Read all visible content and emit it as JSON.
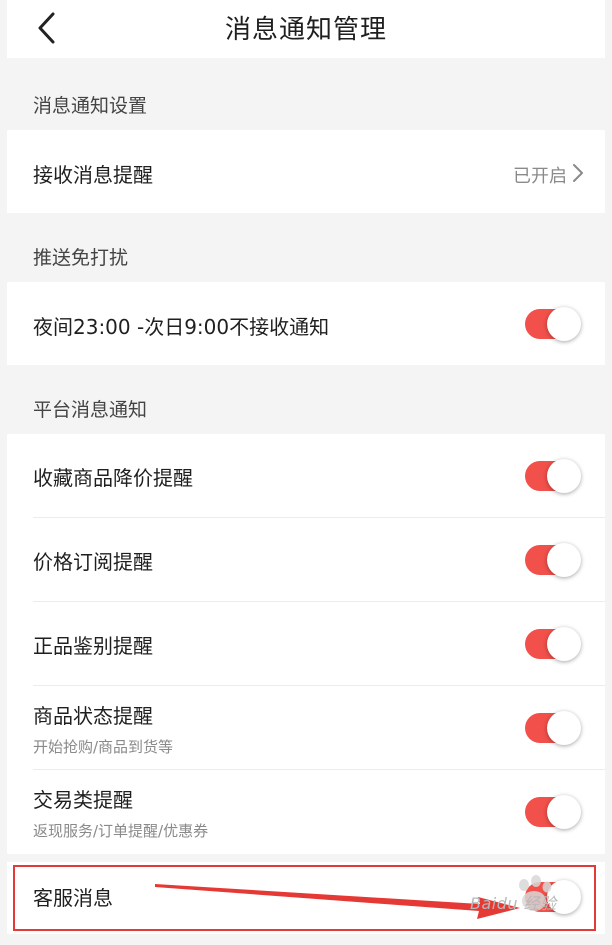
{
  "header": {
    "title": "消息通知管理"
  },
  "sections": {
    "notify": "消息通知设置",
    "dnd": "推送免打扰",
    "platform": "平台消息通知"
  },
  "receive": {
    "label": "接收消息提醒",
    "value": "已开启"
  },
  "night": {
    "label": "夜间23:00 -次日9:00不接收通知",
    "on": true
  },
  "items": [
    {
      "label": "收藏商品降价提醒",
      "sub": "",
      "on": true
    },
    {
      "label": "价格订阅提醒",
      "sub": "",
      "on": true
    },
    {
      "label": "正品鉴别提醒",
      "sub": "",
      "on": true
    },
    {
      "label": "商品状态提醒",
      "sub": "开始抢购/商品到货等",
      "on": true
    },
    {
      "label": "交易类提醒",
      "sub": "返现服务/订单提醒/优惠券",
      "on": true
    },
    {
      "label": "客服消息",
      "sub": "",
      "on": true
    }
  ],
  "watermark": "Baidu 经验",
  "colors": {
    "accent": "#f2504a",
    "annotation": "#e53935"
  }
}
